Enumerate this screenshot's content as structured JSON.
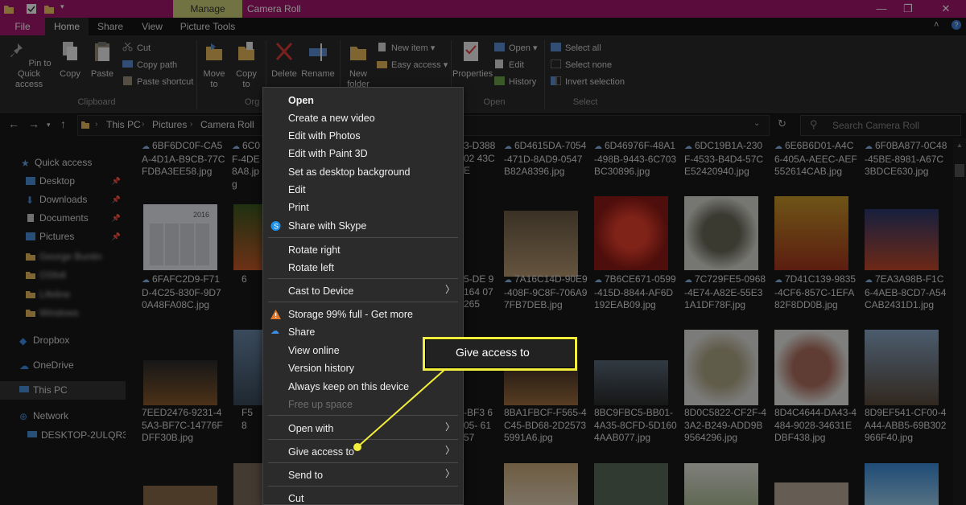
{
  "window": {
    "manage_tab": "Manage",
    "title": "Camera Roll",
    "minimize": "—",
    "maximize": "❐",
    "close": "✕"
  },
  "tabs": {
    "file": "File",
    "home": "Home",
    "share": "Share",
    "view": "View",
    "picture_tools": "Picture Tools"
  },
  "ribbon": {
    "pin": "Pin to Quick access",
    "copy": "Copy",
    "paste": "Paste",
    "cut": "Cut",
    "copy_path": "Copy path",
    "paste_shortcut": "Paste shortcut",
    "clipboard_group": "Clipboard",
    "move_to": "Move to",
    "copy_to": "Copy to",
    "organize_group_partial": "Org",
    "delete": "Delete",
    "rename": "Rename",
    "new_folder": "New folder",
    "new_item": "New item",
    "easy_access": "Easy access",
    "properties": "Properties",
    "open": "Open",
    "edit": "Edit",
    "history": "History",
    "open_group": "Open",
    "select_all": "Select all",
    "select_none": "Select none",
    "invert_selection": "Invert selection",
    "select_group": "Select"
  },
  "address": {
    "this_pc": "This PC",
    "pictures": "Pictures",
    "camera_roll": "Camera Roll",
    "search_placeholder": "Search Camera Roll"
  },
  "nav": {
    "quick_access": "Quick access",
    "desktop": "Desktop",
    "downloads": "Downloads",
    "documents": "Documents",
    "pictures": "Pictures",
    "blurred": [
      "George Buntin",
      "OSfoll",
      "Lifeline",
      "Windows"
    ],
    "dropbox": "Dropbox",
    "onedrive": "OneDrive",
    "this_pc": "This PC",
    "network": "Network",
    "desktop_pc": "DESKTOP-2ULQR3E"
  },
  "files": {
    "row1": [
      {
        "name": "6BF6DC0F-CA5A-4D1A-B9CB-77CFDBA3EE58.jpg"
      },
      {
        "name": "6C0F-4DE8A8.jpg"
      },
      {
        "name": "3-D38802 43CE"
      },
      {
        "name": "6D4615DA-7054-471D-8AD9-0547B82A8396.jpg"
      },
      {
        "name": "6D46976F-48A1-498B-9443-6C703BC30896.jpg"
      },
      {
        "name": "6DC19B1A-230F-4533-B4D4-57CE52420940.jpg"
      },
      {
        "name": "6E6B6D01-A4C6-405A-AEEC-AEF552614CAB.jpg"
      },
      {
        "name": "6F0BA877-0C48-45BE-8981-A67C3BDCE630.jpg"
      }
    ],
    "row2": [
      {
        "name": "6FAFC2D9-F71D-4C25-830F-9D70A48FA08C.jpg"
      },
      {
        "name": "6"
      },
      {
        "name": "5-DE 9164 07265"
      },
      {
        "name": "7A16C14D-90E9-408F-9C8F-706A97FB7DEB.jpg"
      },
      {
        "name": "7B6CE671-0599-415D-8844-AF6D192EAB09.jpg"
      },
      {
        "name": "7C729FE5-0968-4E74-A82E-55E31A1DF78F.jpg"
      },
      {
        "name": "7D41C139-9835-4CF6-857C-1EFA82F8DD0B.jpg"
      },
      {
        "name": "7EA3A98B-F1C6-4AEB-8CD7-A54CAB2431D1.jpg"
      }
    ],
    "row3": [
      {
        "name": "7EED2476-9231-45A3-BF7C-14776FDFF30B.jpg"
      },
      {
        "name": "F5 8"
      },
      {
        "name": "-BF3 605- 6157"
      },
      {
        "name": "8BA1FBCF-F565-4C45-BD68-2D25735991A6.jpg"
      },
      {
        "name": "8BC9FBC5-BB01-4A35-8CFD-5D1604AAB077.jpg"
      },
      {
        "name": "8D0C5822-CF2F-43A2-B249-ADD9B9564296.jpg"
      },
      {
        "name": "8D4C4644-DA43-4484-9028-34631EDBF438.jpg"
      },
      {
        "name": "8D9EF541-CF00-4A44-ABB5-69B302966F40.jpg"
      }
    ],
    "calendar_year": "2016"
  },
  "context_menu": {
    "items": [
      {
        "label": "Open"
      },
      {
        "label": "Create a new video"
      },
      {
        "label": "Edit with Photos"
      },
      {
        "label": "Edit with Paint 3D"
      },
      {
        "label": "Set as desktop background"
      },
      {
        "label": "Edit"
      },
      {
        "label": "Print"
      },
      {
        "label": "Share with Skype"
      },
      {
        "label": "Rotate right"
      },
      {
        "label": "Rotate left"
      },
      {
        "label": "Cast to Device"
      },
      {
        "label": "Storage 99% full - Get more"
      },
      {
        "label": "Share"
      },
      {
        "label": "View online"
      },
      {
        "label": "Version history"
      },
      {
        "label": "Always keep on this device"
      },
      {
        "label": "Free up space"
      },
      {
        "label": "Open with"
      },
      {
        "label": "Give access to"
      },
      {
        "label": "Send to"
      },
      {
        "label": "Cut"
      }
    ]
  },
  "callout": {
    "label": "Give access to",
    "color": "#f2ee3b"
  },
  "colors": {
    "accent": "#a5196e",
    "manage": "#cfd27a",
    "highlight": "#f2ee3b"
  }
}
